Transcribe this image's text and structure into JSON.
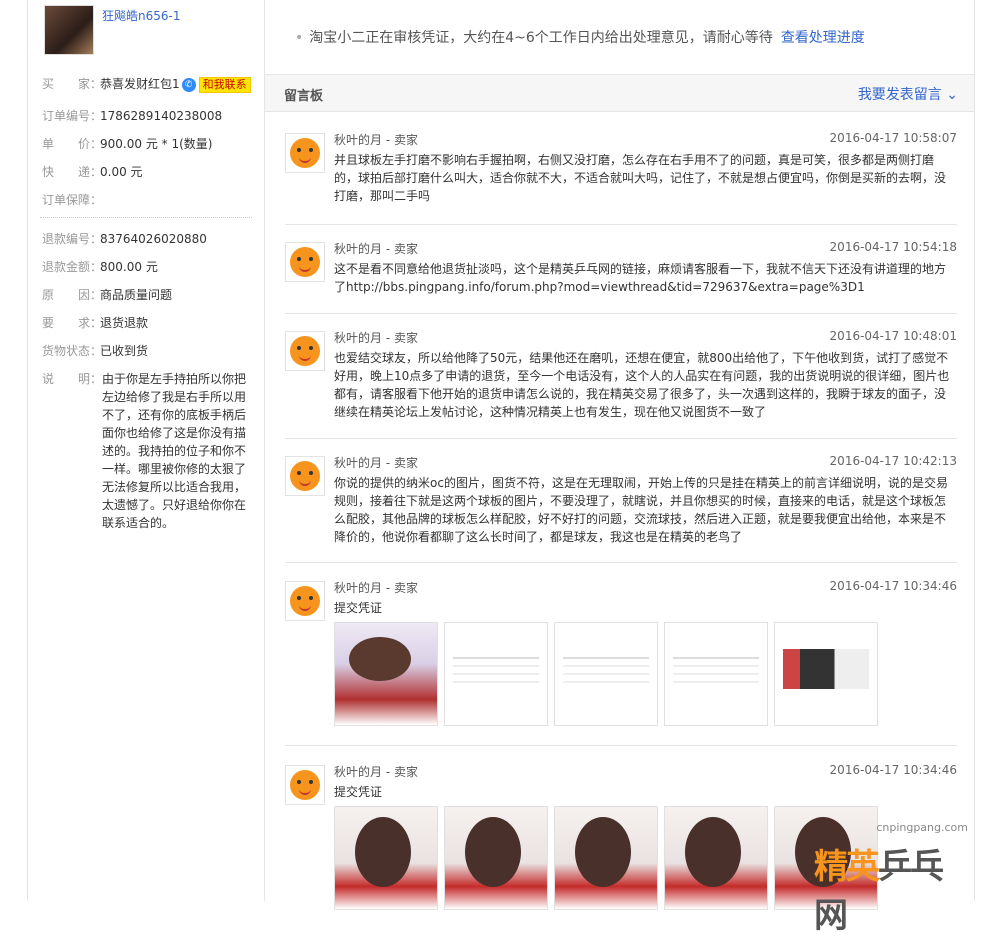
{
  "product": {
    "title": "狂飚皓n656-1"
  },
  "order_info": {
    "buyer_label": "买　　家：",
    "buyer_value": "恭喜发财红包1",
    "contact_label": "和我联系",
    "order_no_label": "订单编号：",
    "order_no": "1786289140238008",
    "price_label": "单　　价：",
    "price_value": "900.00",
    "price_suffix": "元 * 1(数量)",
    "ship_label": "快　　递：",
    "ship_value": "0.00",
    "ship_suffix": "元",
    "guarantee_label": "订单保障："
  },
  "refund_info": {
    "refund_no_label": "退款编号：",
    "refund_no": "83764026020880",
    "refund_amount_label": "退款金额：",
    "refund_amount": "800.00",
    "refund_amount_suffix": "元",
    "reason_label": "原　　因：",
    "reason_value": "商品质量问题",
    "request_label": "要　　求：",
    "request_value": "退货退款",
    "goods_status_label": "货物状态：",
    "goods_status_value": "已收到货",
    "desc_label": "说　　明：",
    "desc_value": "由于你是左手持拍所以你把左边给修了我是右手所以用不了，还有你的底板手柄后面你也给修了这是你没有描述的。我持拍的位子和你不一样。哪里被你修的太狠了无法修复所以比适合我用，太遗憾了。只好退给你你在联系适合的。"
  },
  "notice": {
    "text": "淘宝小二正在审核凭证，大约在4~6个工作日内给出处理意见，请耐心等待",
    "link": "查看处理进度"
  },
  "board": {
    "title": "留言板",
    "post_link": "我要发表留言"
  },
  "messages": [
    {
      "author": "秋叶的月 - 卖家",
      "time": "2016-04-17 10:58:07",
      "body": "并且球板左手打磨不影响右手握拍啊，右侧又没打磨，怎么存在右手用不了的问题，真是可笑，很多都是两侧打磨的，球拍后部打磨什么叫大，适合你就不大，不适合就叫大吗，记住了，不就是想占便宜吗，你倒是买新的去啊，没打磨，那叫二手吗"
    },
    {
      "author": "秋叶的月 - 卖家",
      "time": "2016-04-17 10:54:18",
      "body": "这不是看不同意给他退货扯淡吗，这个是精英乒乓网的链接，麻烦请客服看一下，我就不信天下还没有讲道理的地方了http://bbs.pingpang.info/forum.php?mod=viewthread&tid=729637&extra=page%3D1"
    },
    {
      "author": "秋叶的月 - 卖家",
      "time": "2016-04-17 10:48:01",
      "body": "也爱结交球友，所以给他降了50元，结果他还在磨叽，还想在便宜，就800出给他了，下午他收到货，试打了感觉不好用，晚上10点多了申请的退货，至今一个电话没有，这个人的人品实在有问题，我的出货说明说的很详细，图片也都有，请客服看下他开始的退货申请怎么说的，我在精英交易了很多了，头一次遇到这样的，我瞬于球友的面子，没继续在精英论坛上发帖讨论，这种情况精英上也有发生，现在他又说图货不一致了"
    },
    {
      "author": "秋叶的月 - 卖家",
      "time": "2016-04-17 10:42:13",
      "body": "你说的提供的纳米oc的图片，图货不符，这是在无理取闹，开始上传的只是挂在精英上的前言详细说明，说的是交易规则，接着往下就是这两个球板的图片，不要没理了，就瞎说，并且你想买的时候，直接来的电话，就是这个球板怎么配胶，其他品牌的球板怎么样配胶，好不好打的问题，交流球技，然后进入正题，就是要我便宜出给他，本来是不降价的，他说你看都聊了这么长时间了，都是球友，我这也是在精英的老鸟了"
    },
    {
      "author": "秋叶的月 - 卖家",
      "time": "2016-04-17 10:34:46",
      "body": "提交凭证"
    },
    {
      "author": "秋叶的月 - 卖家",
      "time": "2016-04-17 10:34:46",
      "body": "提交凭证"
    }
  ],
  "watermark": {
    "url": "cnpingpang.com",
    "brand_a": "精英",
    "brand_b": "乒乓网"
  }
}
